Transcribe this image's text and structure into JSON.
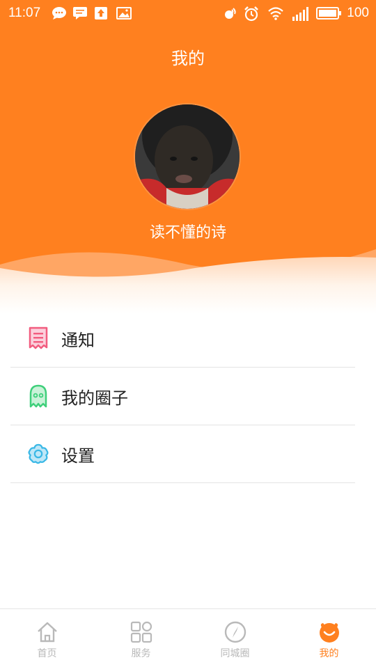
{
  "status_bar": {
    "time": "11:07",
    "battery": "100"
  },
  "header": {
    "title": "我的",
    "username": "读不懂的诗"
  },
  "menu": {
    "items": [
      {
        "label": "通知",
        "icon": "receipt-icon",
        "color": "#f25c7f"
      },
      {
        "label": "我的圈子",
        "icon": "ghost-icon",
        "color": "#3ecf7a"
      },
      {
        "label": "设置",
        "icon": "flower-gear-icon",
        "color": "#3ab8e6"
      }
    ]
  },
  "tabbar": {
    "tabs": [
      {
        "label": "首页",
        "icon": "home-icon"
      },
      {
        "label": "服务",
        "icon": "grid-icon"
      },
      {
        "label": "同城圈",
        "icon": "compass-icon"
      },
      {
        "label": "我的",
        "icon": "smile-icon",
        "active": true
      }
    ]
  },
  "colors": {
    "accent": "#ff801f",
    "inactive": "#b9b9b9"
  }
}
